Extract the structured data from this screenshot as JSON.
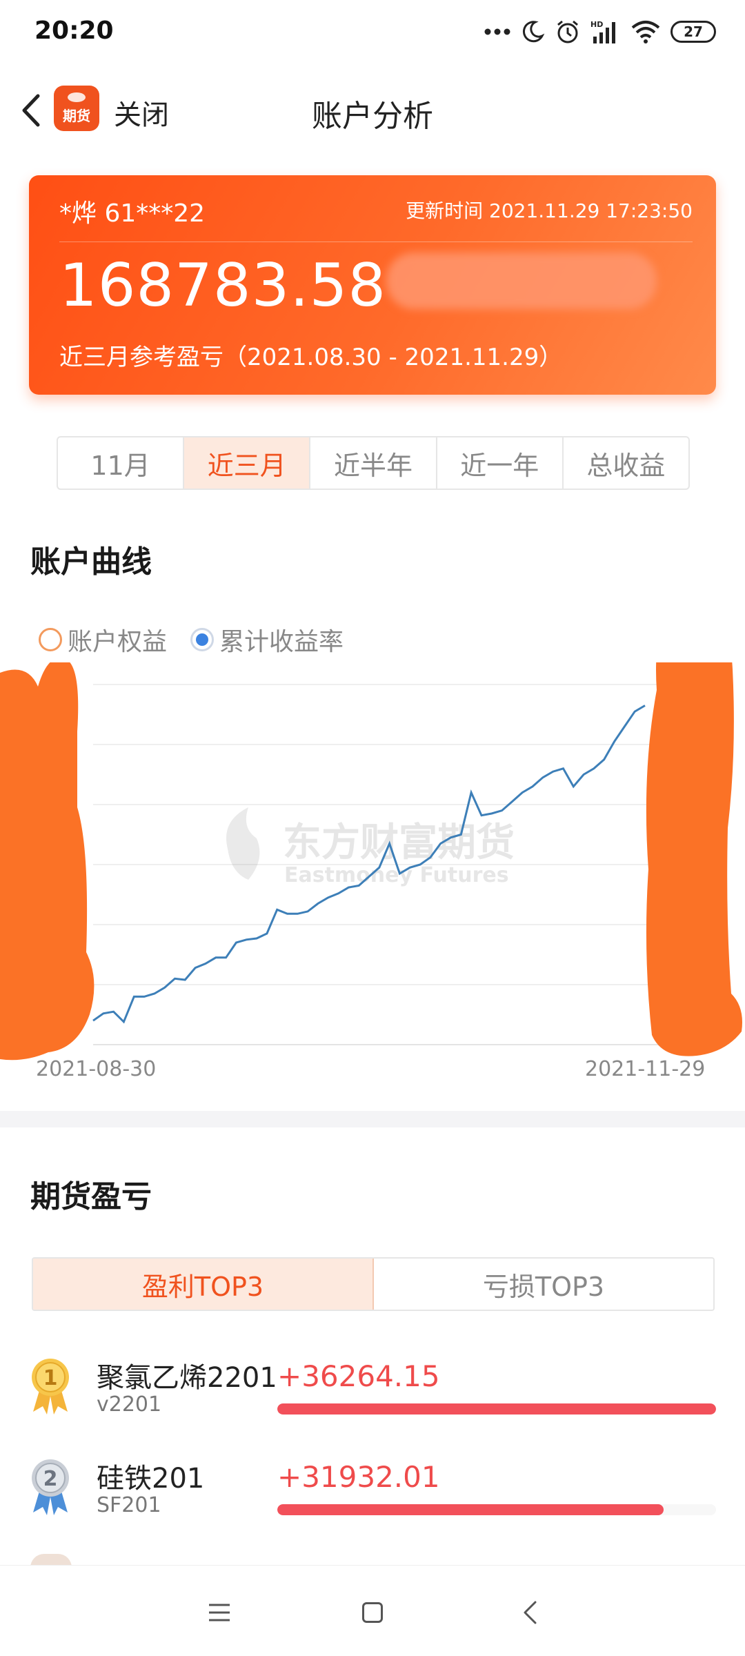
{
  "status_bar": {
    "time": "20:20",
    "battery": "27"
  },
  "nav": {
    "close_label": "关闭",
    "title": "账户分析",
    "logo_text": "期货"
  },
  "account": {
    "name": "*烨 61***22",
    "update_time": "更新时间 2021.11.29 17:23:50",
    "value": "168783.58",
    "period_label": "近三月参考盈亏（2021.08.30 - 2021.11.29）"
  },
  "period_tabs": [
    {
      "label": "11月",
      "active": false
    },
    {
      "label": "近三月",
      "active": true
    },
    {
      "label": "近半年",
      "active": false
    },
    {
      "label": "近一年",
      "active": false
    },
    {
      "label": "总收益",
      "active": false
    }
  ],
  "chart_section": {
    "title": "账户曲线",
    "legend": [
      {
        "label": "账户权益",
        "selected": false
      },
      {
        "label": "累计收益率",
        "selected": true
      }
    ],
    "watermark_cn": "东方财富期货",
    "watermark_en": "Eastmoney Futures"
  },
  "chart_data": {
    "type": "line",
    "x_start": "2021-08-30",
    "x_end": "2021-11-29",
    "grid": true,
    "ylim": [
      0,
      6
    ],
    "series": [
      {
        "color": "#3d7fb8",
        "values": [
          0.4,
          0.52,
          0.55,
          0.38,
          0.8,
          0.8,
          0.85,
          0.95,
          1.1,
          1.08,
          1.28,
          1.35,
          1.45,
          1.45,
          1.7,
          1.75,
          1.77,
          1.85,
          2.25,
          2.18,
          2.18,
          2.22,
          2.35,
          2.45,
          2.52,
          2.62,
          2.65,
          2.8,
          2.95,
          3.35,
          2.85,
          2.95,
          3.0,
          3.12,
          3.35,
          3.45,
          3.5,
          4.2,
          3.82,
          3.85,
          3.9,
          4.05,
          4.2,
          4.3,
          4.45,
          4.55,
          4.6,
          4.3,
          4.5,
          4.6,
          4.75,
          5.05,
          5.3,
          5.55,
          5.65
        ]
      }
    ]
  },
  "pnl_section": {
    "title": "期货盈亏",
    "tabs": [
      {
        "label": "盈利TOP3",
        "active": true
      },
      {
        "label": "亏损TOP3",
        "active": false
      }
    ],
    "items": [
      {
        "rank": "1",
        "name": "聚氯乙烯2201",
        "code": "v2201",
        "pnl": "+36264.15",
        "fill": 1.0
      },
      {
        "rank": "2",
        "name": "硅铁201",
        "code": "SF201",
        "pnl": "+31932.01",
        "fill": 0.88
      }
    ]
  }
}
